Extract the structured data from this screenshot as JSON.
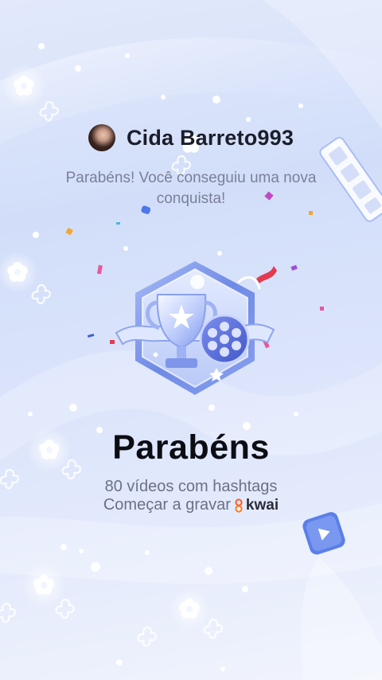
{
  "profile": {
    "username": "Cida Barreto993"
  },
  "message": {
    "text": "Parabéns! Você conseguiu uma nova conquista!"
  },
  "badge": {
    "icon": "trophy-film-reel-badge-icon"
  },
  "achievement": {
    "title": "Parabéns",
    "description": "80 vídeos com hashtags",
    "cta": "Começar a gravar"
  },
  "brand": {
    "name": "kwai",
    "color": "#ff5a1f"
  },
  "colors": {
    "accent": "#5a6fe0",
    "confetti_pink": "#e0468a",
    "confetti_red": "#e23b4f"
  }
}
